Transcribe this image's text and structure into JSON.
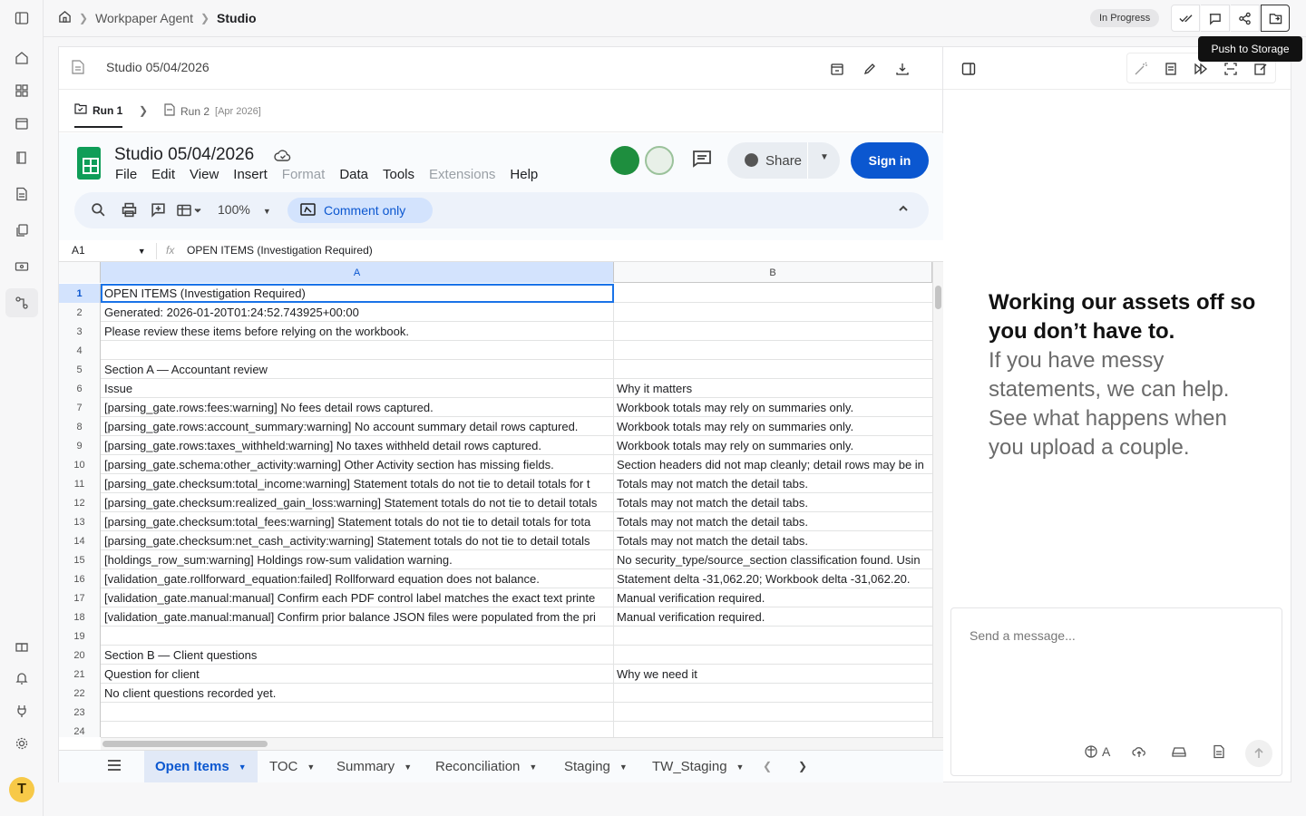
{
  "breadcrumb": {
    "root": "Workpaper Agent",
    "current": "Studio"
  },
  "status_badge": "In Progress",
  "tooltip": "Push to Storage",
  "panel": {
    "title": "Studio 05/04/2026"
  },
  "runs": [
    {
      "label": "Run 1"
    },
    {
      "label": "Run 2",
      "date": "[Apr 2026]"
    }
  ],
  "sheets": {
    "doc_title": "Studio 05/04/2026",
    "menu": [
      "File",
      "Edit",
      "View",
      "Insert",
      "Format",
      "Data",
      "Tools",
      "Extensions",
      "Help"
    ],
    "share_label": "Share",
    "signin_label": "Sign in",
    "zoom": "100%",
    "mode": "Comment only",
    "name_box": "A1",
    "formula": "OPEN ITEMS (Investigation Required)",
    "columns": [
      "A",
      "B"
    ],
    "rows": [
      {
        "n": "1",
        "a": "OPEN ITEMS (Investigation Required)",
        "b": ""
      },
      {
        "n": "2",
        "a": "Generated: 2026-01-20T01:24:52.743925+00:00",
        "b": ""
      },
      {
        "n": "3",
        "a": "Please review these items before relying on the workbook.",
        "b": ""
      },
      {
        "n": "4",
        "a": "",
        "b": ""
      },
      {
        "n": "5",
        "a": "Section A — Accountant review",
        "b": ""
      },
      {
        "n": "6",
        "a": "Issue",
        "b": "Why it matters"
      },
      {
        "n": "7",
        "a": "[parsing_gate.rows:fees:warning] No fees detail rows captured.",
        "b": "Workbook totals may rely on summaries only."
      },
      {
        "n": "8",
        "a": "[parsing_gate.rows:account_summary:warning] No account summary detail rows captured.",
        "b": "Workbook totals may rely on summaries only."
      },
      {
        "n": "9",
        "a": "[parsing_gate.rows:taxes_withheld:warning] No taxes withheld detail rows captured.",
        "b": "Workbook totals may rely on summaries only."
      },
      {
        "n": "10",
        "a": "[parsing_gate.schema:other_activity:warning] Other Activity section has missing fields.",
        "b": "Section headers did not map cleanly; detail rows may be in"
      },
      {
        "n": "11",
        "a": "[parsing_gate.checksum:total_income:warning] Statement totals do not tie to detail totals for t",
        "b": "Totals may not match the detail tabs."
      },
      {
        "n": "12",
        "a": "[parsing_gate.checksum:realized_gain_loss:warning] Statement totals do not tie to detail totals",
        "b": "Totals may not match the detail tabs."
      },
      {
        "n": "13",
        "a": "[parsing_gate.checksum:total_fees:warning] Statement totals do not tie to detail totals for tota",
        "b": "Totals may not match the detail tabs."
      },
      {
        "n": "14",
        "a": "[parsing_gate.checksum:net_cash_activity:warning] Statement totals do not tie to detail totals",
        "b": "Totals may not match the detail tabs."
      },
      {
        "n": "15",
        "a": "[holdings_row_sum:warning] Holdings row-sum validation warning.",
        "b": "No security_type/source_section classification found. Usin"
      },
      {
        "n": "16",
        "a": "[validation_gate.rollforward_equation:failed] Rollforward equation does not balance.",
        "b": "Statement delta -31,062.20; Workbook delta -31,062.20."
      },
      {
        "n": "17",
        "a": "[validation_gate.manual:manual] Confirm each PDF control label matches the exact text printe",
        "b": "Manual verification required."
      },
      {
        "n": "18",
        "a": "[validation_gate.manual:manual] Confirm prior balance JSON files were populated from the pri",
        "b": "Manual verification required."
      },
      {
        "n": "19",
        "a": "",
        "b": ""
      },
      {
        "n": "20",
        "a": "Section B — Client questions",
        "b": ""
      },
      {
        "n": "21",
        "a": "Question for client",
        "b": "Why we need it"
      },
      {
        "n": "22",
        "a": "No client questions recorded yet.",
        "b": ""
      },
      {
        "n": "23",
        "a": "",
        "b": ""
      },
      {
        "n": "24",
        "a": "",
        "b": ""
      }
    ],
    "tabs": [
      "Open Items",
      "TOC",
      "Summary",
      "Reconciliation",
      "Staging",
      "TW_Staging"
    ]
  },
  "assistant": {
    "hero_bold": "Working our assets off so you don’t have to.",
    "hero_body": "If you have messy statements, we can help. See what happens when you upload a couple.",
    "placeholder": "Send a message...",
    "model_label": "A"
  },
  "logo_letter": "T"
}
